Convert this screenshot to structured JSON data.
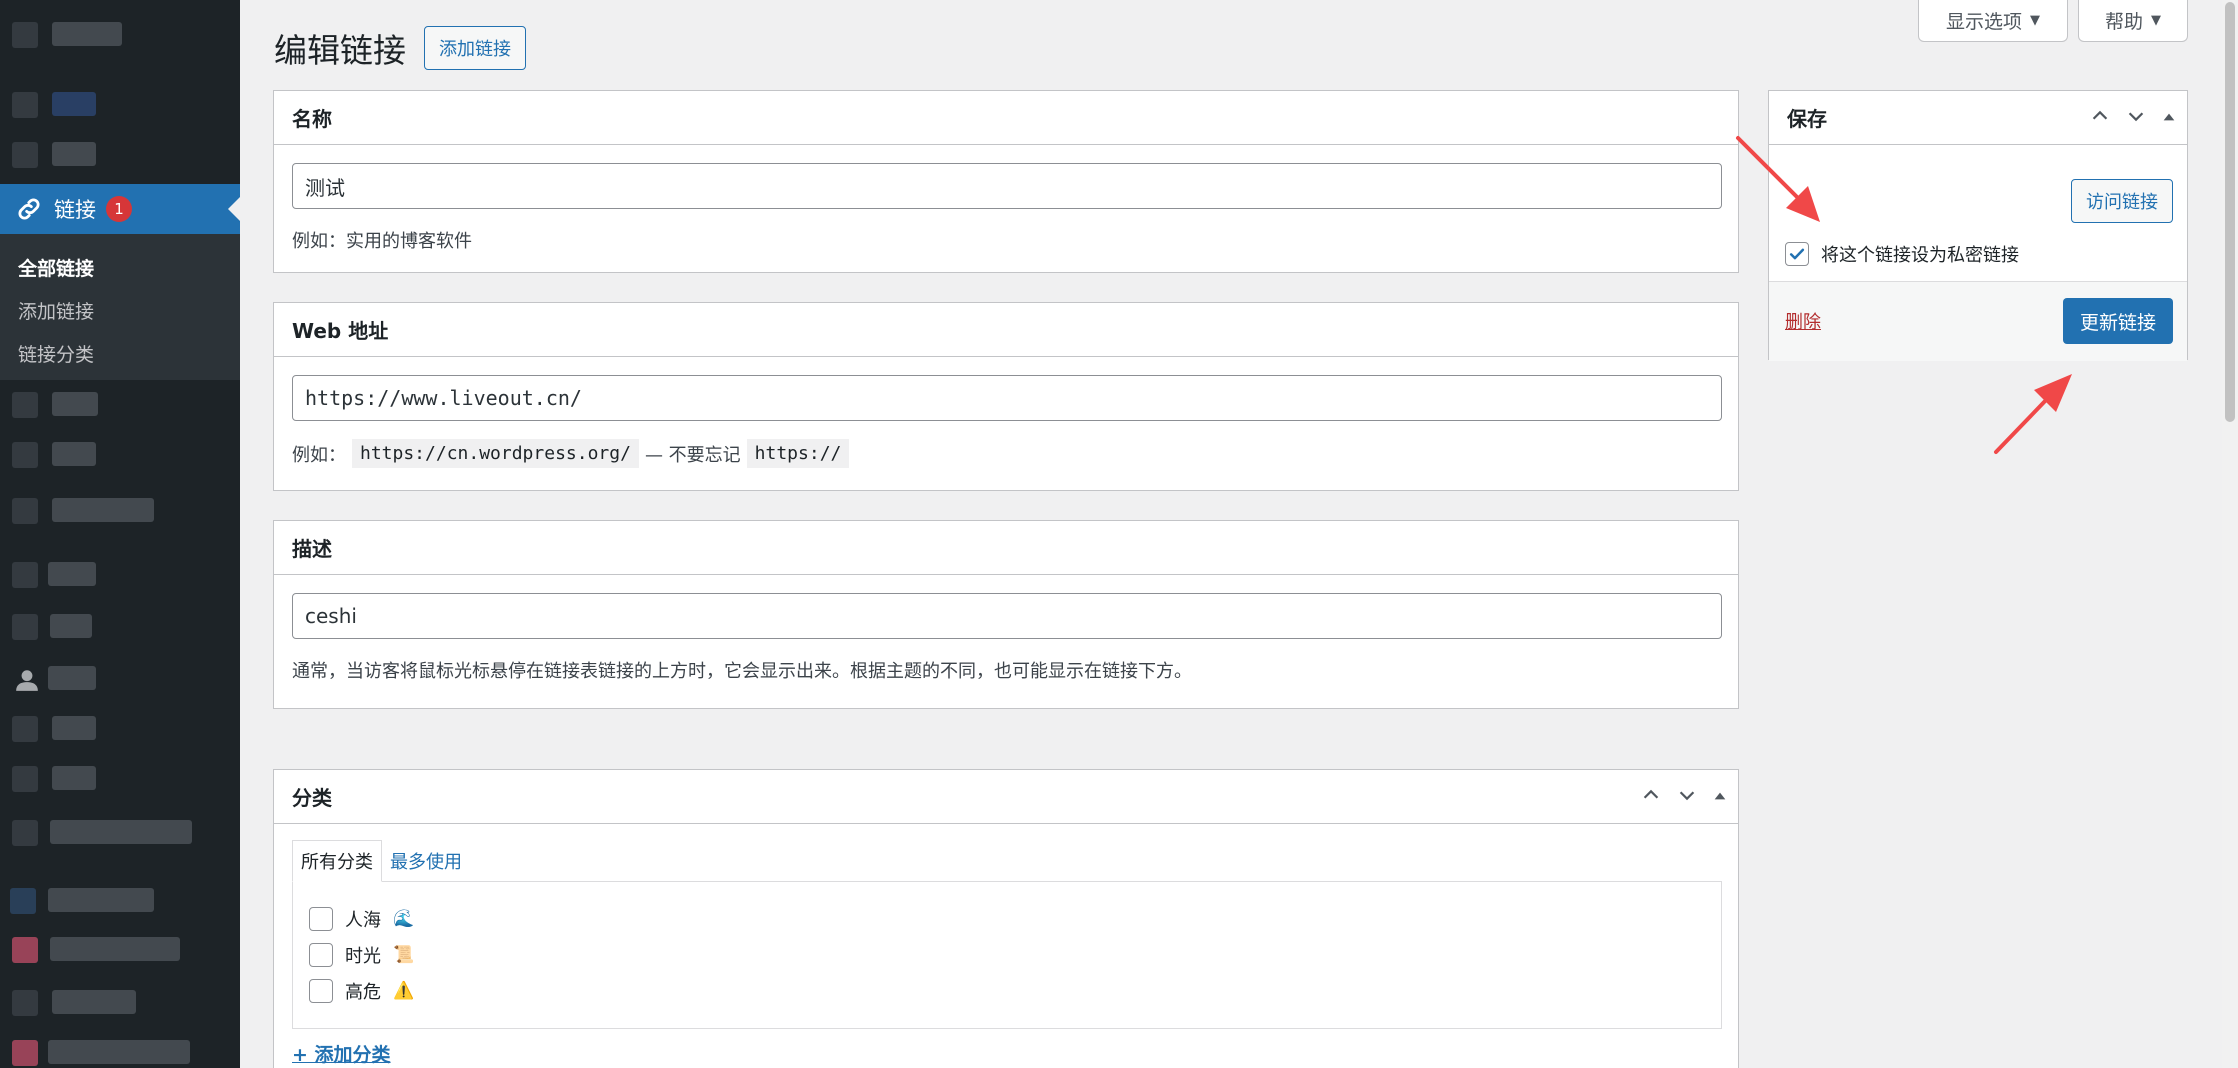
{
  "colors": {
    "accent": "#2271b1",
    "sidebar": "#1d2327",
    "badge": "#d63638",
    "arrow": "#f04848",
    "delete": "#b32d2e"
  },
  "sidebar": {
    "active_item": {
      "label": "链接",
      "badge": "1",
      "icon": "link-icon"
    },
    "submenu": [
      "全部链接",
      "添加链接",
      "链接分类"
    ]
  },
  "screen_buttons": {
    "options": "显示选项",
    "help": "帮助"
  },
  "heading": {
    "title": "编辑链接",
    "add_new": "添加链接"
  },
  "name_box": {
    "title": "名称",
    "value": "测试",
    "hint": "例如：实用的博客软件"
  },
  "web_box": {
    "title": "Web 地址",
    "value": "https://www.liveout.cn/",
    "hint_prefix": "例如：",
    "hint_code1": "https://cn.wordpress.org/",
    "hint_mid": "— 不要忘记",
    "hint_code2": "https://"
  },
  "desc_box": {
    "title": "描述",
    "value": "ceshi",
    "hint": "通常，当访客将鼠标光标悬停在链接表链接的上方时，它会显示出来。根据主题的不同，也可能显示在链接下方。"
  },
  "save_box": {
    "title": "保存",
    "visit_button": "访问链接",
    "private_label": "将这个链接设为私密链接",
    "private_checked": true,
    "delete_link": "删除",
    "update_button": "更新链接"
  },
  "category_box": {
    "title": "分类",
    "tabs": [
      "所有分类",
      "最多使用"
    ],
    "items": [
      {
        "label": "人海",
        "emoji": "🌊",
        "checked": false
      },
      {
        "label": "时光",
        "emoji": "📜",
        "checked": false
      },
      {
        "label": "高危",
        "emoji": "⚠️",
        "checked": false
      }
    ],
    "add_link": "+ 添加分类"
  }
}
